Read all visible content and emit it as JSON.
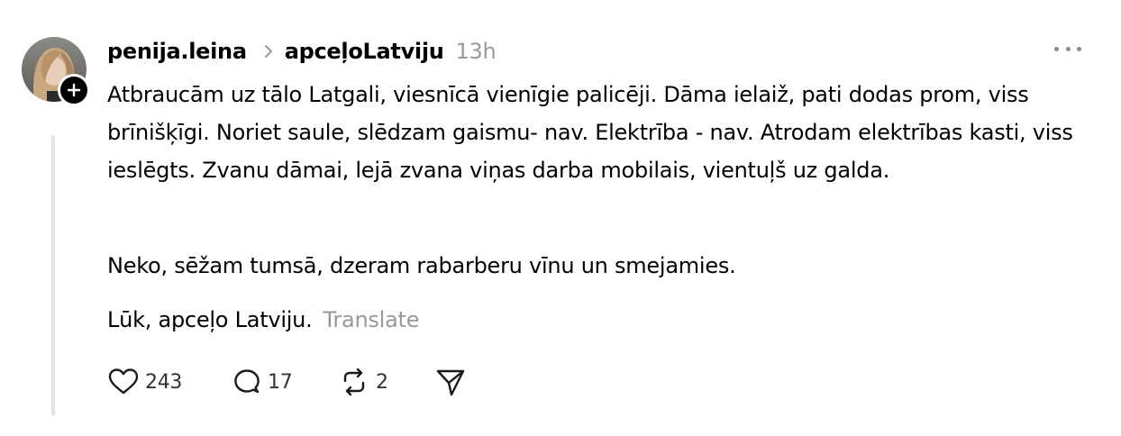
{
  "post": {
    "username": "penija.leina",
    "community": "apceļoLatviju",
    "time": "13h",
    "body": [
      "Atbraucām uz tālo Latgali, viesnīcā vienīgie palicēji. Dāma ielaiž, pati dodas prom, viss brīnišķīgi. Noriet saule, slēdzam gaismu- nav. Elektrība - nav. Atrodam elektrības kasti, viss ieslēgts. Zvanu dāmai, lejā zvana viņas darba mobilais, vientuļš uz galda.",
      "Neko, sēžam tumsā, dzeram rabarberu vīnu un smejamies.",
      "Lūk, apceļo Latviju."
    ],
    "translate_label": "Translate"
  },
  "actions": {
    "likes": "243",
    "comments": "17",
    "reposts": "2"
  },
  "icons": {
    "avatar": "avatar-photo",
    "follow": "plus-icon",
    "chevron": "chevron-right-icon",
    "more": "more-icon",
    "like": "heart-icon",
    "comment": "comment-icon",
    "repost": "repost-icon",
    "share": "send-icon"
  }
}
